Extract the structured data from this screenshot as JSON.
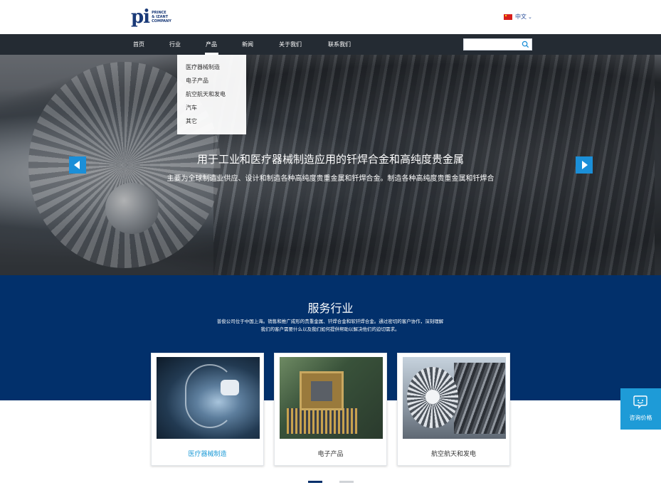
{
  "header": {
    "logo_mark": "pi",
    "logo_line1": "PRINCE",
    "logo_line2": "& IZANT",
    "logo_line3": "COMPANY",
    "language": "中文"
  },
  "nav": {
    "items": [
      {
        "label": "首页"
      },
      {
        "label": "行业"
      },
      {
        "label": "产品"
      },
      {
        "label": "新闻"
      },
      {
        "label": "关于我们"
      },
      {
        "label": "联系我们"
      }
    ],
    "active": "产品",
    "search_placeholder": ""
  },
  "dropdown": {
    "items": [
      {
        "label": "医疗器械制造"
      },
      {
        "label": "电子产品"
      },
      {
        "label": "航空航天和发电"
      },
      {
        "label": "汽车"
      },
      {
        "label": "其它"
      }
    ]
  },
  "hero": {
    "title": "用于工业和医疗器械制造应用的钎焊合金和高纯度贵金属",
    "subtitle": "主要为全球制造业供应、设计和制造各种高纯度贵重金属和钎焊合金。制造各种高纯度贵重金属和钎焊合"
  },
  "services": {
    "title": "服务行业",
    "desc_line1": "普俊公司位于中国上海。销售和推广成形的贵重金属、钎焊合金和软钎焊合金。通过密切的客户协作，深刻理解",
    "desc_line2": "我们的客户需要什么以及我们如何提供帮助以解决他们的迫切需求。",
    "cards": [
      {
        "label": "医疗器械制造"
      },
      {
        "label": "电子产品"
      },
      {
        "label": "航空航天和发电"
      }
    ]
  },
  "float_contact": {
    "label": "咨询价格"
  },
  "colors": {
    "nav_bg": "#242b33",
    "services_bg": "#02306b",
    "accent": "#1e9bd7",
    "arrow": "#1b8fd8"
  }
}
